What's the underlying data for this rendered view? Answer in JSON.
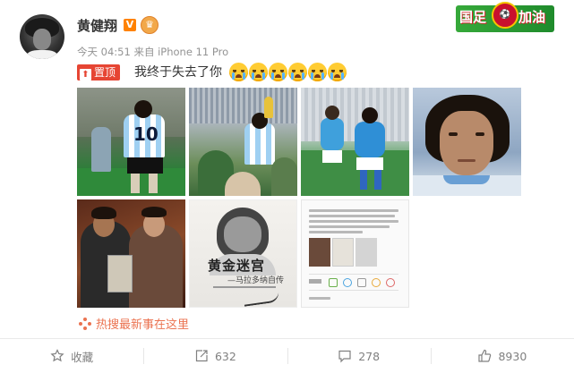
{
  "user": {
    "name": "黄健翔",
    "verified_badge": "V",
    "meta": "今天 04:51 来自 iPhone 11 Pro"
  },
  "banner": {
    "left": "国足",
    "right": "加油"
  },
  "post": {
    "pinned_label": "置顶",
    "text": "我终于失去了你",
    "emoji_count": 6,
    "photos": [
      {
        "name": "photo-maradona-back-10"
      },
      {
        "name": "photo-world-cup-trophy"
      },
      {
        "name": "photo-napoli-match"
      },
      {
        "name": "photo-maradona-portrait"
      },
      {
        "name": "photo-with-huang-jianxiang"
      },
      {
        "name": "photo-book-cover"
      },
      {
        "name": "photo-weibo-screenshot"
      }
    ],
    "photo6_title": "黄金迷宫",
    "photo6_subtitle": "—马拉多纳自传"
  },
  "hot_search": "热搜最新事在这里",
  "actions": {
    "favorite": "收藏",
    "repost": "632",
    "comment": "278",
    "like": "8930"
  },
  "colors": {
    "accent_orange": "#eb7350",
    "pinned_red": "#e64533",
    "verified_orange": "#ff8200"
  }
}
